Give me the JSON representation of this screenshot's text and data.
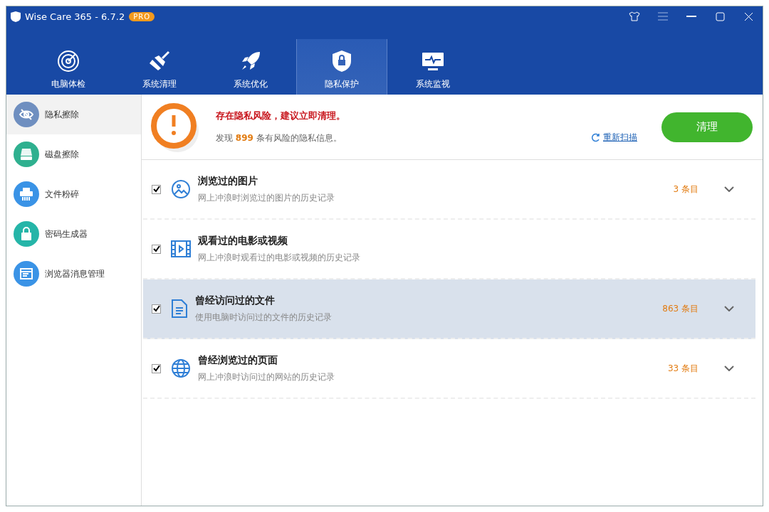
{
  "window": {
    "title": "Wise Care 365 - 6.7.2",
    "badge": "PRO"
  },
  "tabs": [
    {
      "label": "电脑体检",
      "selected": false
    },
    {
      "label": "系统清理",
      "selected": false
    },
    {
      "label": "系统优化",
      "selected": false
    },
    {
      "label": "隐私保护",
      "selected": true
    },
    {
      "label": "系统监视",
      "selected": false
    }
  ],
  "sidebar": {
    "items": [
      {
        "label": "隐私擦除",
        "selected": true,
        "color": "#6f8fc0"
      },
      {
        "label": "磁盘擦除",
        "selected": false,
        "color": "#2fb08f"
      },
      {
        "label": "文件粉碎",
        "selected": false,
        "color": "#3a93e6"
      },
      {
        "label": "密码生成器",
        "selected": false,
        "color": "#25b5a8"
      },
      {
        "label": "浏览器消息管理",
        "selected": false,
        "color": "#3a93e6"
      }
    ]
  },
  "alert": {
    "title": "存在隐私风险，建议立即清理。",
    "summary_before": "发现",
    "count": "899",
    "summary_after": "条有风险的隐私信息。",
    "rescan": "重新扫描",
    "clean_button": "清理"
  },
  "items": [
    {
      "title": "浏览过的图片",
      "description": "网上冲浪时浏览过的图片的历史记录",
      "checked": true,
      "selected": false,
      "count": "3 条目"
    },
    {
      "title": "观看过的电影或视频",
      "description": "网上冲浪时观看过的电影或视频的历史记录",
      "checked": true,
      "selected": false
    },
    {
      "title": "曾经访问过的文件",
      "description": "使用电脑时访问过的文件的历史记录",
      "checked": true,
      "selected": true,
      "count": "863 条目"
    },
    {
      "title": "曾经浏览过的页面",
      "description": "网上冲浪时访问过的网站的历史记录",
      "checked": true,
      "selected": false,
      "count": "33 条目"
    }
  ]
}
